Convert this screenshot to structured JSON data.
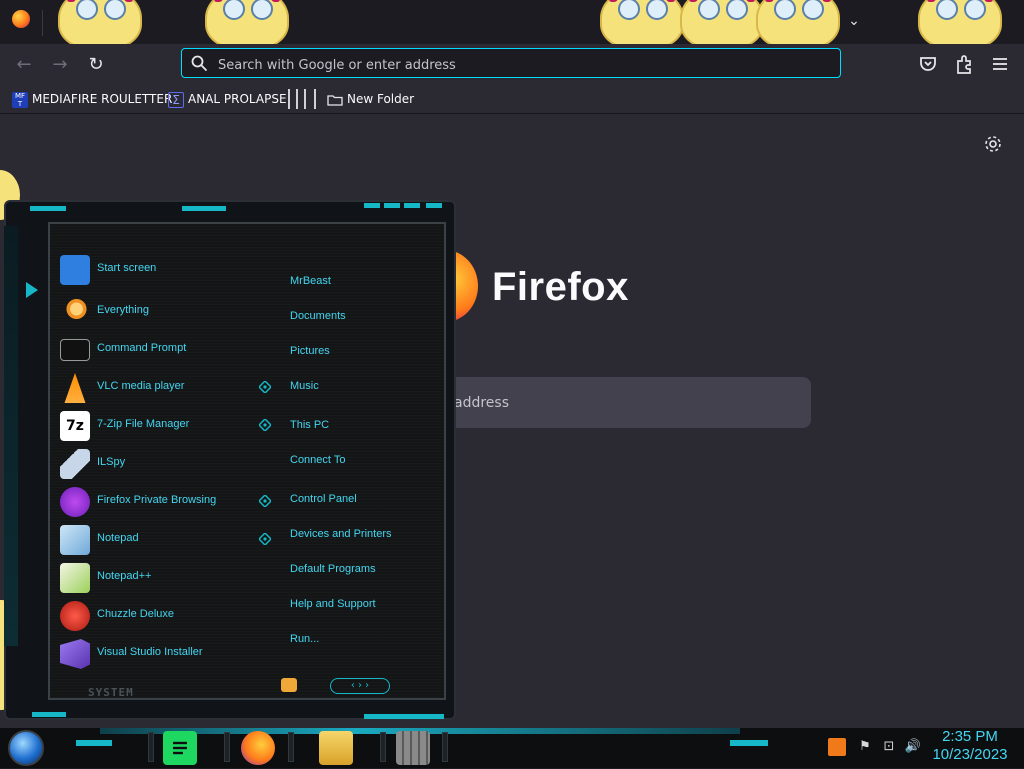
{
  "browser": {
    "url_placeholder": "Search with Google or enter address",
    "tab_list_glyph": "⌄",
    "nav": {
      "back_glyph": "←",
      "forward_glyph": "→",
      "reload_glyph": "↻"
    },
    "bookmarks": [
      {
        "label": "MEDIAFIRE ROULETTER",
        "icon": "mediafire-icon"
      },
      {
        "label": "ANAL PROLAPSE",
        "icon": "sigma-icon"
      },
      {
        "label": "New Folder",
        "icon": "folder-icon"
      }
    ],
    "colors": {
      "accent": "#00ddff",
      "toolbar": "#2b2a33",
      "tabstrip": "#1c1b22"
    }
  },
  "newtab": {
    "brand": "Firefox",
    "search_placeholder_tail": "address"
  },
  "startmenu": {
    "programs": [
      {
        "label": "Start screen",
        "icon": "start-screen-icon",
        "color": "#2f7fe0"
      },
      {
        "label": "Everything",
        "icon": "magnifier-icon",
        "color": "#f09020"
      },
      {
        "label": "Command Prompt",
        "icon": "cmd-icon",
        "color": "#111111"
      },
      {
        "label": "VLC media player",
        "icon": "vlc-cone-icon",
        "color": "#ff8c00"
      },
      {
        "label": "7-Zip File Manager",
        "icon": "7zip-icon",
        "color": "#ffffff"
      },
      {
        "label": "ILSpy",
        "icon": "ilspy-icon",
        "color": "#9cb4d8"
      },
      {
        "label": "Firefox Private Browsing",
        "icon": "firefox-private-icon",
        "color": "#8a2be2"
      },
      {
        "label": "Notepad",
        "icon": "notepad-icon",
        "color": "#7fb8e6"
      },
      {
        "label": "Notepad++",
        "icon": "notepad-plus-icon",
        "color": "#9bd15a"
      },
      {
        "label": "Chuzzle Deluxe",
        "icon": "chuzzle-icon",
        "color": "#d33a2c"
      },
      {
        "label": "Visual Studio Installer",
        "icon": "vs-installer-icon",
        "color": "#7b52c7"
      }
    ],
    "places": [
      {
        "label": "MrBeast"
      },
      {
        "label": "Documents"
      },
      {
        "label": "Pictures"
      },
      {
        "label": "Music"
      },
      {
        "label": "This PC"
      },
      {
        "label": "Connect To"
      },
      {
        "label": "Control Panel"
      },
      {
        "label": "Devices and Printers"
      },
      {
        "label": "Default Programs"
      },
      {
        "label": "Help and Support"
      },
      {
        "label": "Run..."
      }
    ],
    "system_label": "SYSTEM",
    "nav_glyphs": "‹  ›  ›"
  },
  "taskbar": {
    "apps": [
      {
        "name": "spotify-like-app-icon",
        "color": "#1ed760"
      },
      {
        "name": "firefox-icon",
        "color": "#ff7a1a"
      },
      {
        "name": "file-explorer-icon",
        "color": "#f0c84a"
      },
      {
        "name": "firewall-icon",
        "color": "#8a8a8a"
      }
    ],
    "clock": {
      "time": "2:35 PM",
      "date": "10/23/2023"
    },
    "tray": {
      "flag_glyph": "⚑",
      "network_glyph": "⊡",
      "volume_glyph": "🔊"
    }
  }
}
